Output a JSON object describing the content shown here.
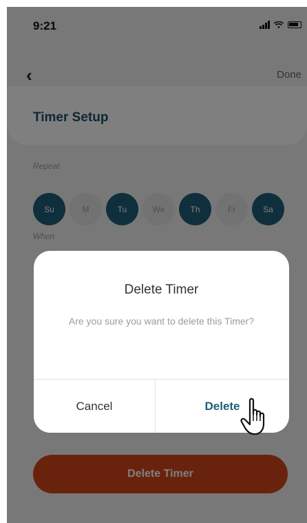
{
  "status": {
    "time": "9:21"
  },
  "header": {
    "done_label": "Done",
    "title": "Timer Setup"
  },
  "repeat": {
    "label": "Repeat",
    "days": [
      {
        "label": "Su",
        "selected": true
      },
      {
        "label": "M",
        "selected": false
      },
      {
        "label": "Tu",
        "selected": true
      },
      {
        "label": "We",
        "selected": false
      },
      {
        "label": "Th",
        "selected": true
      },
      {
        "label": "Fr",
        "selected": false
      },
      {
        "label": "Sa",
        "selected": true
      }
    ]
  },
  "when": {
    "label": "When"
  },
  "delete_timer_button": {
    "label": "Delete Timer"
  },
  "dialog": {
    "title": "Delete Timer",
    "message": "Are you sure you want to delete this Timer?",
    "cancel_label": "Cancel",
    "delete_label": "Delete"
  },
  "colors": {
    "accent": "#1f5f7a",
    "danger": "#d3471b",
    "title": "#1f4e6b"
  }
}
